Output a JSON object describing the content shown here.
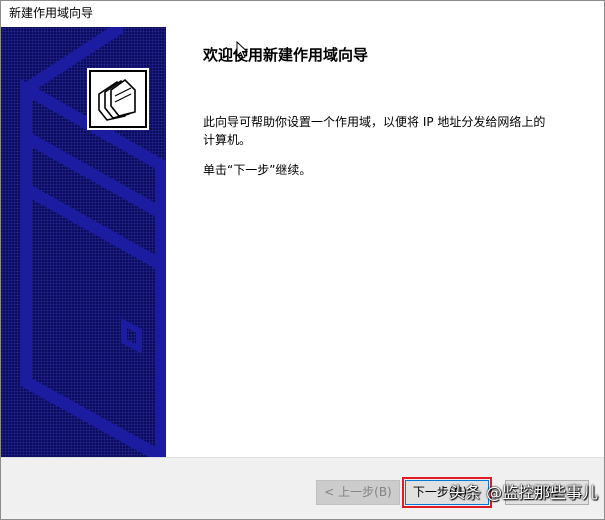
{
  "window": {
    "title": "新建作用域向导"
  },
  "icons": {
    "wizard": "folder-stack-icon",
    "cursor": "mouse-pointer-icon"
  },
  "content": {
    "heading": "欢迎使用新建作用域向导",
    "description": "此向导可帮助你设置一个作用域，以便将 IP 地址分发给网络上的计算机。",
    "continue_hint": "单击“下一步”继续。"
  },
  "buttons": {
    "back": "< 上一步(B)",
    "next": "下一步(N) >",
    "cancel": "取消"
  },
  "watermark": "头条 @监控那些事儿",
  "colors": {
    "panel_background": "#0a0a5e",
    "panel_stroke": "#1c1ca0",
    "highlight": "#e01b24",
    "focus_border": "#0078d7"
  }
}
